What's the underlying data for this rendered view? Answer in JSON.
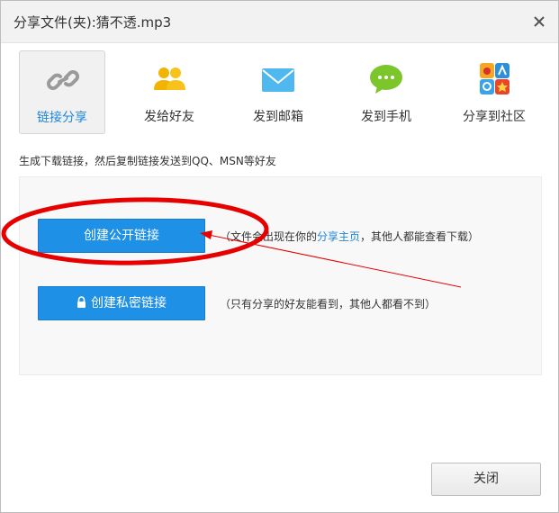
{
  "dialog": {
    "title": "分享文件(夹):猜不透.mp3"
  },
  "tabs": [
    {
      "label": "链接分享",
      "icon": "link-icon",
      "active": true
    },
    {
      "label": "发给好友",
      "icon": "friends-icon",
      "active": false
    },
    {
      "label": "发到邮箱",
      "icon": "mail-icon",
      "active": false
    },
    {
      "label": "发到手机",
      "icon": "chat-bubble-icon",
      "active": false
    },
    {
      "label": "分享到社区",
      "icon": "social-grid-icon",
      "active": false
    }
  ],
  "hint": "生成下载链接，然后复制链接发送到QQ、MSN等好友",
  "public_link": {
    "button_label": "创建公开链接",
    "desc_before": "（文件会出现在你的",
    "desc_link": "分享主页",
    "desc_after": "，其他人都能查看下载）"
  },
  "private_link": {
    "button_label": "创建私密链接",
    "icon": "lock-icon",
    "desc": "（只有分享的好友能看到，其他人都看不到）"
  },
  "footer": {
    "close_label": "关闭"
  },
  "colors": {
    "accent": "#1e90e6",
    "active_tab_text": "#1e86dd",
    "annotation": "#e60000"
  }
}
